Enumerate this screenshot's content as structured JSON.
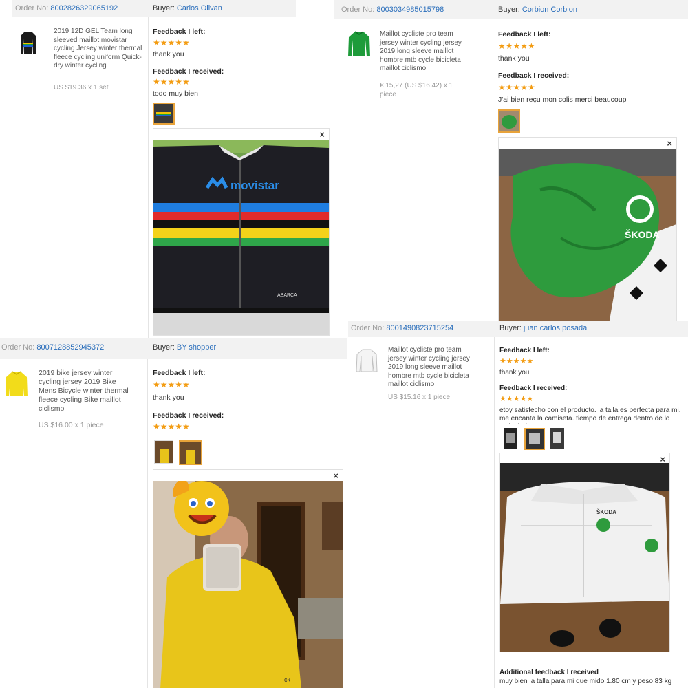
{
  "labels": {
    "order_no": "Order No:",
    "buyer": "Buyer:",
    "feedback_left": "Feedback I left:",
    "feedback_received": "Feedback I received:",
    "additional_feedback": "Additional feedback I received"
  },
  "colors": {
    "star": "#f39c12",
    "link": "#2a6ebb",
    "highlight_border": "#e8a33a"
  },
  "orders": [
    {
      "order_no": "8002826329065192",
      "buyer": "Carlos Olivan",
      "product": "2019 12D GEL Team long sleeved maillot movistar cycling Jersey winter thermal fleece cycling uniform Quick-dry winter cycling",
      "price": "US $19.36 x 1 set",
      "feedback_left_rating": 5,
      "feedback_left_text": "thank you",
      "feedback_received_rating": 5,
      "feedback_received_text": "todo muy bien",
      "close_icon": "×",
      "photo_text": "movistar",
      "photo_small_text": "ABARCA"
    },
    {
      "order_no": "8003034985015798",
      "buyer": "Corbion Corbion",
      "product": "Maillot cycliste pro team jersey winter cycling jersey 2019 long sleeve maillot hombre mtb cycle bicicleta maillot ciclismo",
      "price": "€ 15,27 (US $16.42) x 1 piece",
      "feedback_left_rating": 5,
      "feedback_left_text": "thank you",
      "feedback_received_rating": 5,
      "feedback_received_text": "J'ai bien reçu mon colis merci beaucoup",
      "close_icon": "×",
      "photo_text": "ŠKODA"
    },
    {
      "order_no": "8007128852945372",
      "buyer": "BY shopper",
      "product": "2019 bike jersey winter cycling jersey 2019 Bike Mens Bicycle winter thermal fleece cycling Bike maillot ciclismo",
      "price": "US $16.00 x 1 piece",
      "feedback_left_rating": 5,
      "feedback_left_text": "thank you",
      "feedback_received_rating": 5,
      "close_icon": "×"
    },
    {
      "order_no": "8001490823715254",
      "buyer": "juan carlos posada",
      "product": "Maillot cycliste pro team jersey winter cycling jersey 2019 long sleeve maillot hombre mtb cycle bicicleta maillot ciclismo",
      "price": "US $15.16 x 1 piece",
      "feedback_left_rating": 5,
      "feedback_left_text": "thank you",
      "feedback_received_rating": 5,
      "feedback_received_text": "etoy satisfecho con el producto. la talla es perfecta para mi. me encanta la camiseta. tiempo de entrega dentro de lo estipulado.",
      "additional_feedback_text": "muy bien la talla para mi que mido 1.80 cm y peso 83 kg",
      "close_icon": "×",
      "photo_text": "ŠKODA"
    }
  ]
}
